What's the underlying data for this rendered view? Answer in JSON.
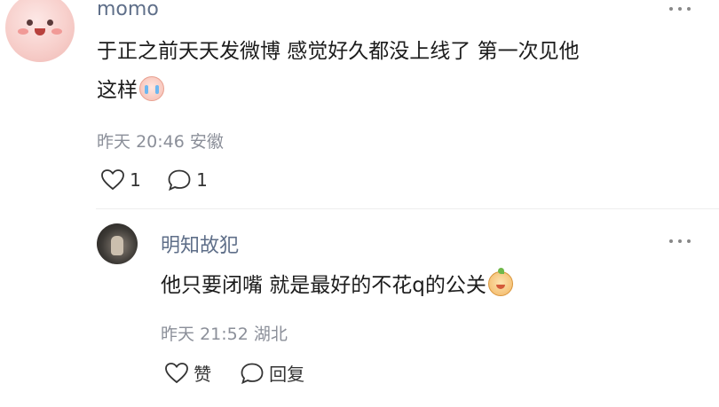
{
  "comment": {
    "username": "momo",
    "text": "于正之前天天发微博 感觉好久都没上线了 第一次见他这样",
    "text_line1": "于正之前天天发微博 感觉好久都没上线了 第一次见他",
    "text_line2": "这样",
    "emoji": "crying-emoji",
    "date": "昨天",
    "time": "20:46",
    "location": "安徽",
    "likes": "1",
    "replies": "1"
  },
  "reply": {
    "username": "明知故犯",
    "text": "他只要闭嘴 就是最好的不花q的公关",
    "emoji": "tangerine-emoji",
    "date": "昨天",
    "time": "21:52",
    "location": "湖北",
    "like_label": "赞",
    "reply_label": "回复"
  },
  "icons": {
    "more": "more-dots-icon",
    "like": "heart-outline-icon",
    "comment": "comment-bubble-icon"
  },
  "colors": {
    "username": "#5f6f89",
    "meta": "#8b8f99",
    "text": "#1c1c1c"
  }
}
